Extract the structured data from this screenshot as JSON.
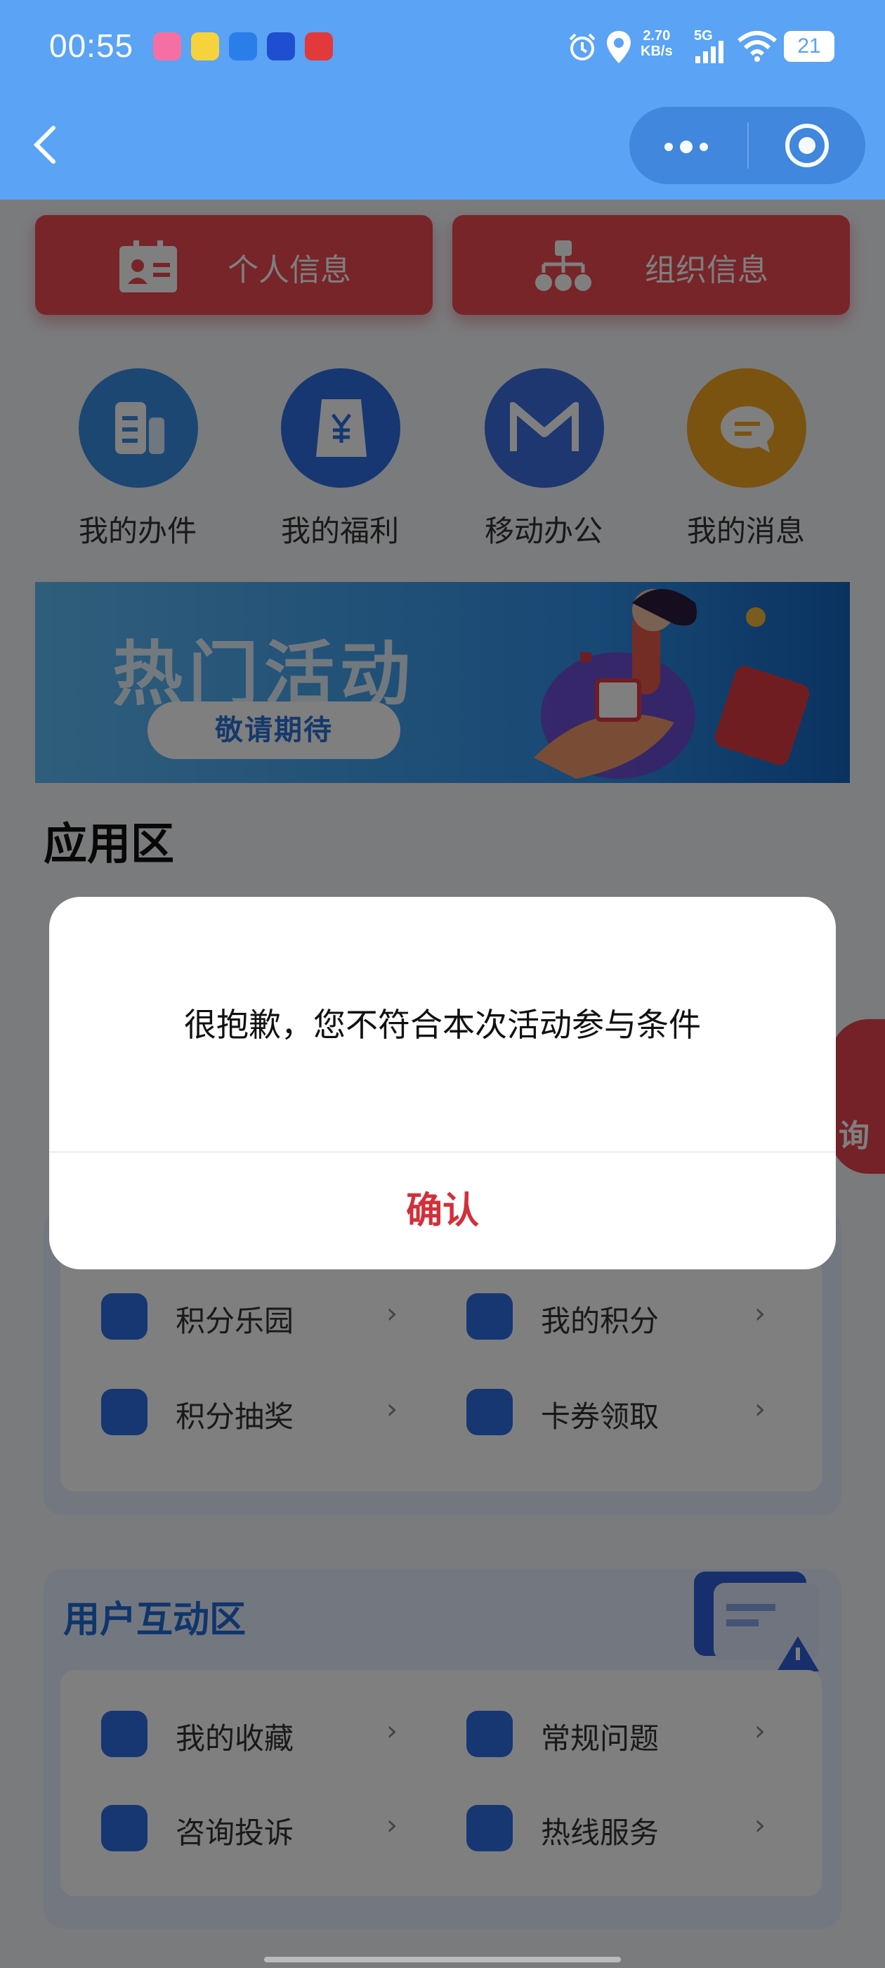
{
  "status_bar": {
    "time": "00:55",
    "net_speed_value": "2.70",
    "net_speed_unit": "KB/s",
    "signal": "5G",
    "battery": "21",
    "app_icons": [
      "bilibili-icon",
      "game-icon",
      "chat-icon",
      "browser-icon",
      "news-icon"
    ]
  },
  "nav": {
    "more_icon": "more-dots-icon",
    "close_icon": "target-close-icon"
  },
  "top_buttons": [
    {
      "label": "个人信息",
      "icon": "id-card-icon"
    },
    {
      "label": "组织信息",
      "icon": "org-chart-icon"
    }
  ],
  "quick_actions": [
    {
      "label": "我的办件",
      "icon": "document-icon",
      "color": "#3a8fe6"
    },
    {
      "label": "我的福利",
      "icon": "yen-bag-icon",
      "color": "#2f6fe4"
    },
    {
      "label": "移动办公",
      "icon": "m-logo-icon",
      "color": "#3d6fe0"
    },
    {
      "label": "我的消息",
      "icon": "message-icon",
      "color": "#f5a623"
    }
  ],
  "banner": {
    "title": "热门活动",
    "button": "敬请期待"
  },
  "app_section": {
    "title": "应用区"
  },
  "points_panel": {
    "items": [
      {
        "label": "积分乐园",
        "icon": "crown-icon"
      },
      {
        "label": "我的积分",
        "icon": "coins-icon"
      },
      {
        "label": "积分抽奖",
        "icon": "gift-icon"
      },
      {
        "label": "卡券领取",
        "icon": "ticket-icon"
      }
    ]
  },
  "interaction_panel": {
    "title": "用户互动区",
    "items": [
      {
        "label": "我的收藏",
        "icon": "shield-check-icon"
      },
      {
        "label": "常规问题",
        "icon": "question-icon"
      },
      {
        "label": "咨询投诉",
        "icon": "chat-bubble-icon"
      },
      {
        "label": "热线服务",
        "icon": "phone-icon"
      }
    ]
  },
  "floating": {
    "label": "询"
  },
  "dialog": {
    "message": "很抱歉，您不符合本次活动参与条件",
    "confirm": "确认"
  },
  "colors": {
    "header": "#5aa3f5",
    "red_button": "#ef4a52",
    "confirm_text": "#d32f3a",
    "accent_blue": "#2f6fe4"
  }
}
